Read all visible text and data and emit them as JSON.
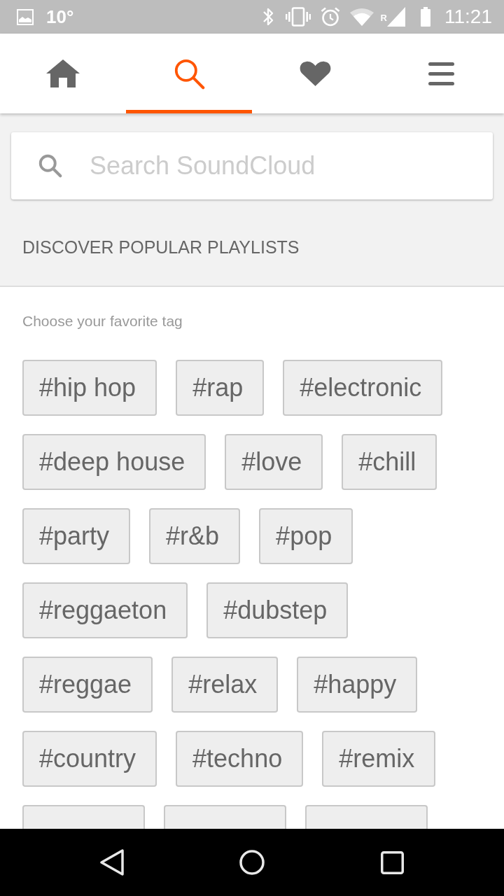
{
  "status_bar": {
    "temperature": "10°",
    "roaming_mark": "R",
    "time": "11:21"
  },
  "tabs": [
    {
      "kind": "home",
      "selected": false
    },
    {
      "kind": "search",
      "selected": true
    },
    {
      "kind": "heart",
      "selected": false
    },
    {
      "kind": "menu",
      "selected": false
    }
  ],
  "search": {
    "placeholder": "Search SoundCloud"
  },
  "section": {
    "heading": "DISCOVER POPULAR PLAYLISTS",
    "subtitle": "Choose your favorite tag"
  },
  "tags": [
    {
      "kind": "tag",
      "label": "#hip hop"
    },
    {
      "kind": "tag",
      "label": "#rap"
    },
    {
      "kind": "tag",
      "label": "#electronic"
    },
    {
      "kind": "tag",
      "label": "#deep house"
    },
    {
      "kind": "tag",
      "label": "#love"
    },
    {
      "kind": "tag",
      "label": "#chill"
    },
    {
      "kind": "tag",
      "label": "#party"
    },
    {
      "kind": "tag",
      "label": "#r&b"
    },
    {
      "kind": "tag",
      "label": "#pop"
    },
    {
      "kind": "tag",
      "label": "#reggaeton"
    },
    {
      "kind": "tag",
      "label": "#dubstep"
    },
    {
      "kind": "tag",
      "label": "#reggae"
    },
    {
      "kind": "tag",
      "label": "#relax"
    },
    {
      "kind": "tag",
      "label": "#happy"
    },
    {
      "kind": "tag",
      "label": "#country"
    },
    {
      "kind": "tag",
      "label": "#techno"
    },
    {
      "kind": "tag",
      "label": "#remix"
    },
    {
      "kind": "cut-off"
    },
    {
      "kind": "cut-off"
    },
    {
      "kind": "cut-off"
    }
  ],
  "nav_bar": [
    {
      "kind": "back"
    },
    {
      "kind": "home"
    },
    {
      "kind": "recents"
    }
  ]
}
